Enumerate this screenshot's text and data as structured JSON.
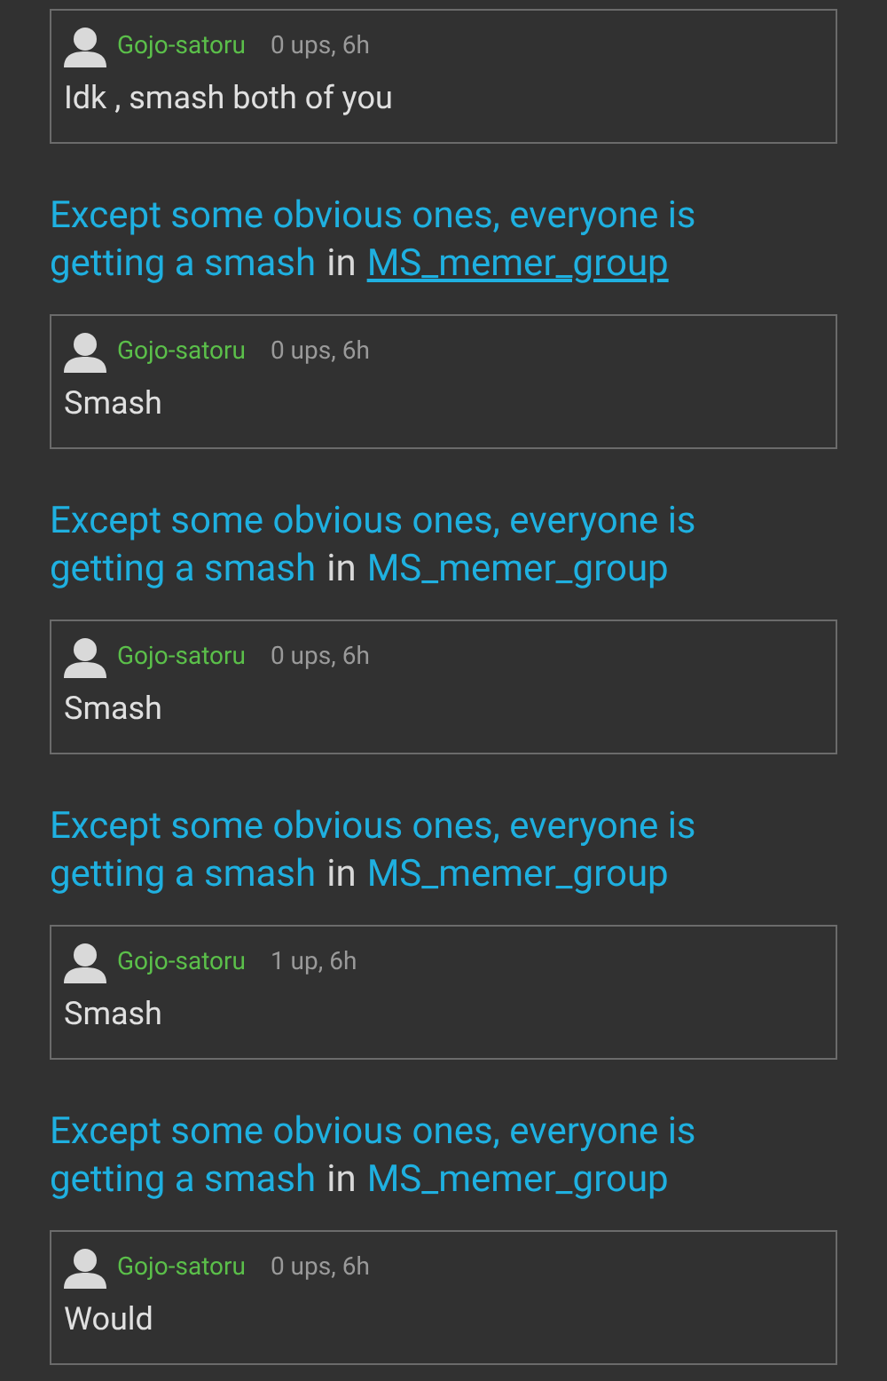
{
  "feed": [
    {
      "kind": "comment",
      "author": "Gojo-satoru",
      "meta": "0 ups, 6h",
      "text": "Idk , smash both of you"
    },
    {
      "kind": "post",
      "title": [
        "Except some obvious ones, everyone is",
        "getting a smash"
      ],
      "in": "in",
      "group": "MS_memer_group",
      "underlined": true
    },
    {
      "kind": "comment",
      "author": "Gojo-satoru",
      "meta": "0 ups, 6h",
      "text": "Smash"
    },
    {
      "kind": "post",
      "title": [
        "Except some obvious ones, everyone is",
        "getting a smash"
      ],
      "in": "in",
      "group": "MS_memer_group",
      "underlined": false
    },
    {
      "kind": "comment",
      "author": "Gojo-satoru",
      "meta": "0 ups, 6h",
      "text": "Smash"
    },
    {
      "kind": "post",
      "title": [
        "Except some obvious ones, everyone is",
        "getting a smash"
      ],
      "in": "in",
      "group": "MS_memer_group",
      "underlined": false
    },
    {
      "kind": "comment",
      "author": "Gojo-satoru",
      "meta": "1 up, 6h",
      "text": "Smash"
    },
    {
      "kind": "post",
      "title": [
        "Except some obvious ones, everyone is",
        "getting a smash"
      ],
      "in": "in",
      "group": "MS_memer_group",
      "underlined": false
    },
    {
      "kind": "comment",
      "author": "Gojo-satoru",
      "meta": "0 ups, 6h",
      "text": "Would"
    }
  ]
}
